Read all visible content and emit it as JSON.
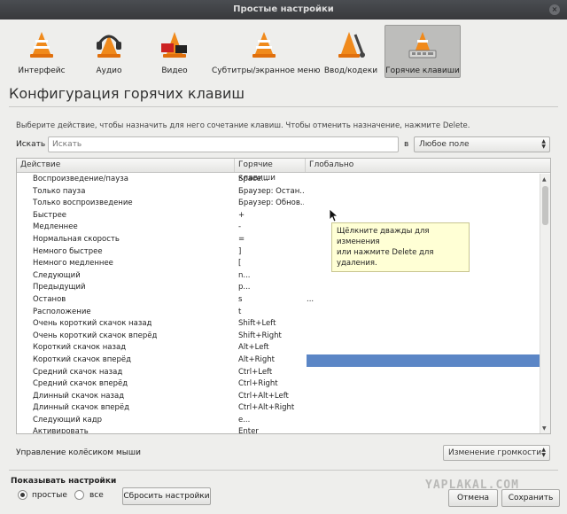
{
  "window": {
    "title": "Простые настройки",
    "close_glyph": "×"
  },
  "categories": [
    {
      "label": "Интерфейс",
      "icon": "vlc-cone-icon",
      "active": false
    },
    {
      "label": "Аудио",
      "icon": "headphones-cone-icon",
      "active": false
    },
    {
      "label": "Видео",
      "icon": "film-cone-icon",
      "active": false
    },
    {
      "label": "Субтитры/экранное меню",
      "icon": "subtitles-cone-icon",
      "active": false
    },
    {
      "label": "Ввод/кодеки",
      "icon": "input-codecs-cone-icon",
      "active": false
    },
    {
      "label": "Горячие клавиши",
      "icon": "hotkeys-cone-icon",
      "active": true
    }
  ],
  "page": {
    "heading": "Конфигурация горячих клавиш",
    "instructions": "Выберите действие, чтобы назначить для него сочетание клавиш. Чтобы отменить назначение, нажмите Delete.",
    "search_label": "Искать",
    "search_placeholder": "Искать",
    "in_label": "в",
    "field_selected": "Любое поле"
  },
  "table": {
    "headers": [
      "Действие",
      "Горячие клавиши",
      "Глобально"
    ],
    "rows": [
      {
        "action": "Воспроизведение/пауза",
        "hotkey": "Space...",
        "global": ""
      },
      {
        "action": "Только пауза",
        "hotkey": "Браузер: Остан...",
        "global": ""
      },
      {
        "action": "Только воспроизведение",
        "hotkey": "Браузер: Обнов...",
        "global": ""
      },
      {
        "action": "Быстрее",
        "hotkey": "+",
        "global": ""
      },
      {
        "action": "Медленнее",
        "hotkey": "-",
        "global": ""
      },
      {
        "action": "Нормальная скорость",
        "hotkey": "=",
        "global": ""
      },
      {
        "action": "Немного быстрее",
        "hotkey": "]",
        "global": ""
      },
      {
        "action": "Немного медленнее",
        "hotkey": "[",
        "global": ""
      },
      {
        "action": "Следующий",
        "hotkey": "n...",
        "global": ""
      },
      {
        "action": "Предыдущий",
        "hotkey": "p...",
        "global": ""
      },
      {
        "action": "Останов",
        "hotkey": "s",
        "global": "..."
      },
      {
        "action": "Расположение",
        "hotkey": "t",
        "global": ""
      },
      {
        "action": "Очень короткий скачок назад",
        "hotkey": "Shift+Left",
        "global": ""
      },
      {
        "action": "Очень короткий скачок вперёд",
        "hotkey": "Shift+Right",
        "global": ""
      },
      {
        "action": "Короткий скачок назад",
        "hotkey": "Alt+Left",
        "global": ""
      },
      {
        "action": "Короткий скачок вперёд",
        "hotkey": "Alt+Right",
        "global": "",
        "selected": true
      },
      {
        "action": "Средний скачок назад",
        "hotkey": "Ctrl+Left",
        "global": ""
      },
      {
        "action": "Средний скачок вперёд",
        "hotkey": "Ctrl+Right",
        "global": ""
      },
      {
        "action": "Длинный скачок назад",
        "hotkey": "Ctrl+Alt+Left",
        "global": ""
      },
      {
        "action": "Длинный скачок вперёд",
        "hotkey": "Ctrl+Alt+Right",
        "global": ""
      },
      {
        "action": "Следующий кадр",
        "hotkey": "e...",
        "global": ""
      },
      {
        "action": "Активировать",
        "hotkey": "Enter",
        "global": ""
      }
    ]
  },
  "tooltip": {
    "line1": "Щёлкните дважды для изменения",
    "line2": "или нажмите Delete для удаления."
  },
  "mouse_wheel": {
    "label": "Управление колёсиком мыши",
    "selected": "Изменение громкости"
  },
  "show_settings": {
    "label": "Показывать настройки",
    "options": [
      {
        "label": "простые",
        "checked": true
      },
      {
        "label": "все",
        "checked": false
      }
    ]
  },
  "buttons": {
    "reset": "Сбросить настройки",
    "cancel": "Отмена",
    "save": "Сохранить"
  },
  "watermark": "YAPLAKAL.COM",
  "colors": {
    "selection": "#5b86c6",
    "tooltip_bg": "#ffffd5",
    "cone_orange": "#f08a1c"
  }
}
